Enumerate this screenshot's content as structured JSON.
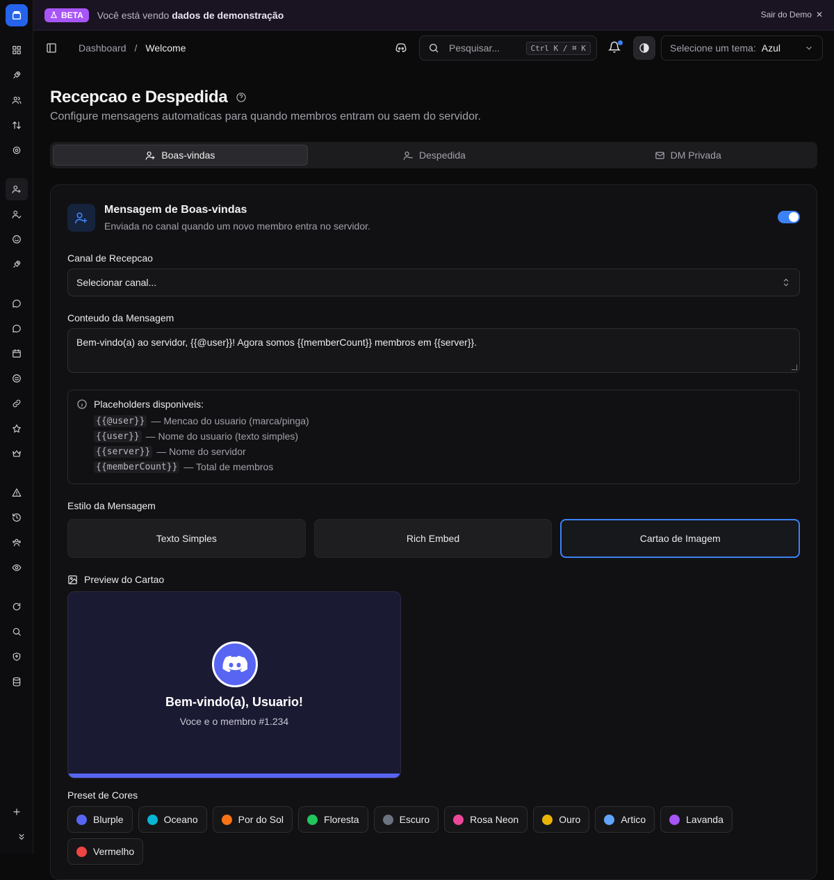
{
  "beta": {
    "badge": "BETA",
    "text_prefix": "Você está vendo ",
    "text_bold": "dados de demonstração",
    "exit_label": "Sair do Demo"
  },
  "breadcrumb": {
    "root": "Dashboard",
    "separator": "/",
    "current": "Welcome"
  },
  "search": {
    "placeholder": "Pesquisar...",
    "shortcut": "Ctrl K / ⌘ K"
  },
  "theme": {
    "label": "Selecione um tema:",
    "value": "Azul"
  },
  "page": {
    "title": "Recepcao e Despedida",
    "subtitle": "Configure mensagens automaticas para quando membros entram ou saem do servidor."
  },
  "tabs": [
    {
      "label": "Boas-vindas",
      "icon": "user-plus-icon",
      "active": true
    },
    {
      "label": "Despedida",
      "icon": "user-minus-icon",
      "active": false
    },
    {
      "label": "DM Privada",
      "icon": "mail-icon",
      "active": false
    }
  ],
  "card": {
    "title": "Mensagem de Boas-vindas",
    "description": "Enviada no canal quando um novo membro entra no servidor.",
    "enabled": true,
    "channel_label": "Canal de Recepcao",
    "channel_value": "Selecionar canal...",
    "content_label": "Conteudo da Mensagem",
    "content_value": "Bem-vindo(a) ao servidor, {{@user}}! Agora somos {{memberCount}} membros em {{server}}.",
    "placeholders_title": "Placeholders disponiveis:",
    "placeholders": [
      {
        "code": "{{@user}}",
        "desc": "— Mencao do usuario (marca/pinga)"
      },
      {
        "code": "{{user}}",
        "desc": "— Nome do usuario (texto simples)"
      },
      {
        "code": "{{server}}",
        "desc": "— Nome do servidor"
      },
      {
        "code": "{{memberCount}}",
        "desc": "— Total de membros"
      }
    ],
    "style_label": "Estilo da Mensagem",
    "styles": [
      "Texto Simples",
      "Rich Embed",
      "Cartao de Imagem"
    ],
    "style_selected": "Cartao de Imagem",
    "preview_label": "Preview do Cartao",
    "preview": {
      "welcome": "Bem-vindo(a), Usuario!",
      "member": "Voce e o membro #1.234"
    },
    "presets_label": "Preset de Cores",
    "presets": [
      {
        "name": "Blurple",
        "color": "#5865f2"
      },
      {
        "name": "Oceano",
        "color": "#06b6d4"
      },
      {
        "name": "Por do Sol",
        "color": "#f97316"
      },
      {
        "name": "Floresta",
        "color": "#22c55e"
      },
      {
        "name": "Escuro",
        "color": "#6b7280"
      },
      {
        "name": "Rosa Neon",
        "color": "#ec4899"
      },
      {
        "name": "Ouro",
        "color": "#eab308"
      },
      {
        "name": "Artico",
        "color": "#60a5fa"
      },
      {
        "name": "Lavanda",
        "color": "#a855f7"
      },
      {
        "name": "Vermelho",
        "color": "#ef4444"
      }
    ]
  }
}
